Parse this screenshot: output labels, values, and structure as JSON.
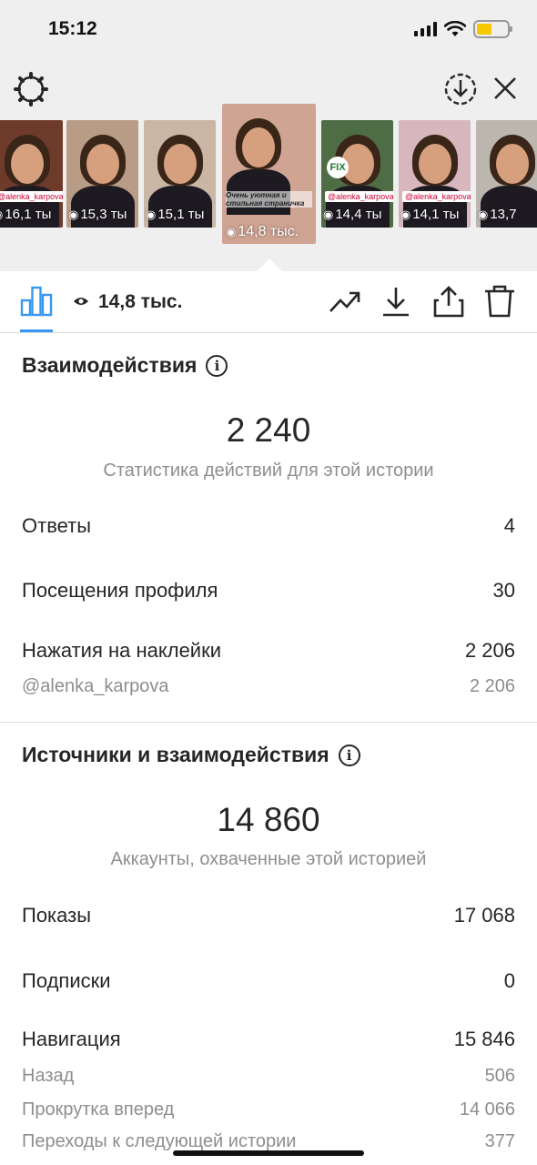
{
  "status": {
    "time": "15:12"
  },
  "thumbnails": [
    {
      "views": "16,1 ты",
      "bg": "#6e3b2a",
      "tag": "@alenka_karpova"
    },
    {
      "views": "15,3 ты",
      "bg": "#b99c86",
      "tag": ""
    },
    {
      "views": "15,1 ты",
      "bg": "#c9b6a5",
      "tag": ""
    },
    {
      "views": "14,8 тыс.",
      "bg": "#cfa493",
      "tag": "",
      "caption": "Очень уютная и стильная страничка"
    },
    {
      "views": "14,4 ты",
      "bg": "#4f6d45",
      "tag": "@alenka_karpova",
      "badge": "FIX"
    },
    {
      "views": "14,1 ты",
      "bg": "#d7b6bd",
      "tag": "@alenka_karpova"
    },
    {
      "views": "13,7",
      "bg": "#bcb7ae",
      "tag": ""
    }
  ],
  "toolbar": {
    "views": "14,8 тыс."
  },
  "interactions": {
    "title": "Взаимодействия",
    "total": "2 240",
    "caption": "Статистика действий для этой истории",
    "rows": [
      {
        "label": "Ответы",
        "value": "4"
      },
      {
        "label": "Посещения профиля",
        "value": "30"
      },
      {
        "label": "Нажатия на наклейки",
        "value": "2 206"
      }
    ],
    "sub_rows": [
      {
        "label": "@alenka_karpova",
        "value": "2 206"
      }
    ]
  },
  "discovery": {
    "title": "Источники и взаимодействия",
    "total": "14 860",
    "caption": "Аккаунты, охваченные этой историей",
    "rows": [
      {
        "label": "Показы",
        "value": "17 068"
      },
      {
        "label": "Подписки",
        "value": "0"
      },
      {
        "label": "Навигация",
        "value": "15 846"
      }
    ],
    "sub_rows": [
      {
        "label": "Назад",
        "value": "506"
      },
      {
        "label": "Прокрутка вперед",
        "value": "14 066"
      },
      {
        "label": "Переходы к следующей истории",
        "value": "377"
      }
    ]
  },
  "icons": {
    "settings": "gear-icon",
    "download_story": "download-circle-icon",
    "close": "close-icon",
    "insights": "bar-chart-icon",
    "eye": "eye-icon",
    "promote": "trending-up-icon",
    "save": "download-icon",
    "share": "share-icon",
    "delete": "trash-icon"
  },
  "colors": {
    "accent": "#3897f0",
    "background_top": "#efefef",
    "muted_text": "#8e8e8e"
  }
}
